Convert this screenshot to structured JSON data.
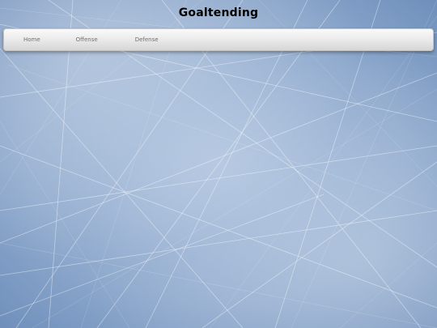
{
  "header": {
    "title": "Goaltending"
  },
  "nav": {
    "items": [
      {
        "label": "Home"
      },
      {
        "label": "Offense"
      },
      {
        "label": "Defense"
      }
    ]
  },
  "colors": {
    "background": "#8ea9cd",
    "title_text": "#000000",
    "nav_text": "#6f6f6f",
    "nav_bar": "#ececec"
  }
}
